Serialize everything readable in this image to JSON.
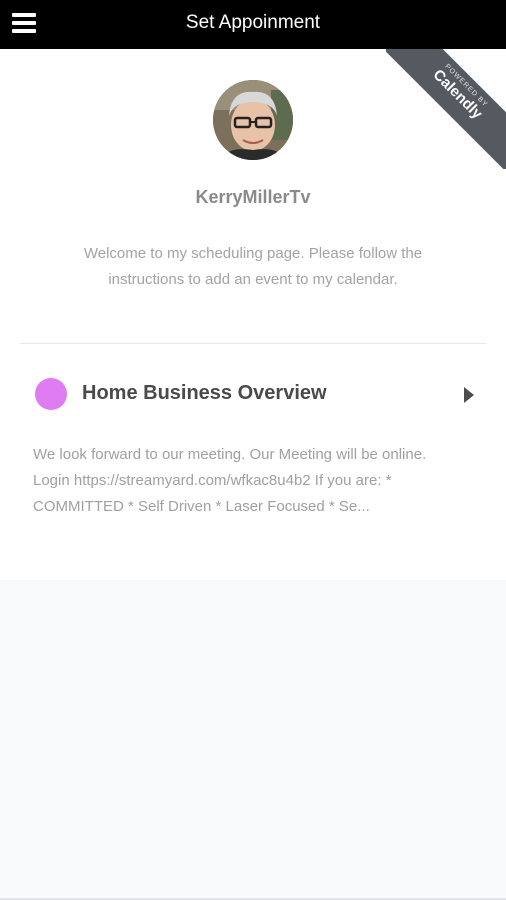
{
  "header": {
    "title": "Set Appoinment",
    "menu_icon": "hamburger-icon"
  },
  "badge": {
    "line1": "POWERED BY",
    "line2": "Calendly"
  },
  "profile": {
    "name": "KerryMillerTv",
    "welcome": "Welcome to my scheduling page. Please follow the instructions to add an event to my calendar."
  },
  "event": {
    "name": "Home Business Overview",
    "color": "#e07cf2",
    "arrow_icon": "chevron-right-icon",
    "description": "We look forward to our meeting. Our Meeting will be online. Login https://streamyard.com/wfkac8u4b2 If you are: * COMMITTED * Self Driven * Laser Focused * Se..."
  }
}
